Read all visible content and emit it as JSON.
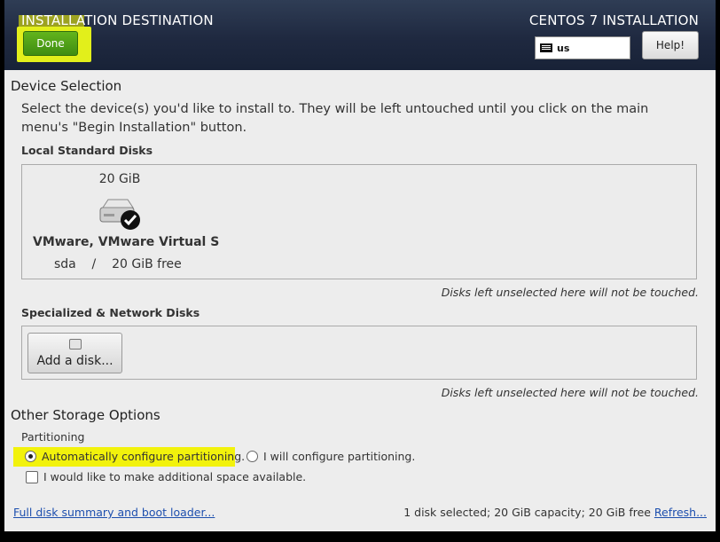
{
  "header": {
    "title": "INSTALLATION DESTINATION",
    "done_label": "Done",
    "product": "CENTOS 7 INSTALLATION",
    "keyboard_layout": "us",
    "help_label": "Help!"
  },
  "device_selection": {
    "title": "Device Selection",
    "description": "Select the device(s) you'd like to install to.  They will be left untouched until you click on the main menu's \"Begin Installation\" button.",
    "local_disks_label": "Local Standard Disks",
    "disk": {
      "size": "20 GiB",
      "name": "VMware, VMware Virtual S",
      "info": "sda    /    20 GiB free"
    },
    "note": "Disks left unselected here will not be touched.",
    "specialized_label": "Specialized & Network Disks",
    "add_disk_label": "Add a disk...",
    "note2": "Disks left unselected here will not be touched."
  },
  "other_storage": {
    "title": "Other Storage Options",
    "partitioning_label": "Partitioning",
    "auto_label": "Automatically configure partitioning.",
    "manual_label": "I will configure partitioning.",
    "space_label": "I would like to make additional space available."
  },
  "footer": {
    "summary_link": "Full disk summary and boot loader...",
    "status": "1 disk selected; 20 GiB capacity; 20 GiB free",
    "refresh_link": "Refresh..."
  },
  "colors": {
    "header_bg": "#1f2940",
    "done_green": "#4f9e16",
    "highlight_yellow": "#f2f20c",
    "link_blue": "#1d4fae"
  }
}
